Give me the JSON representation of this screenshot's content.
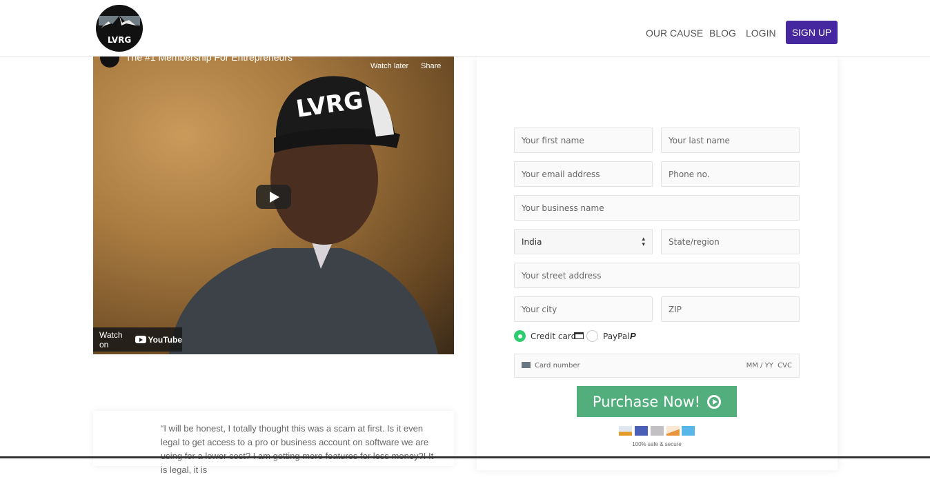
{
  "header": {
    "logo_text": "LVRG",
    "nav": [
      "OUR CAUSE",
      "BLOG",
      "LOGIN"
    ],
    "signup_label": "SIGN UP",
    "signup_color": "#4527a0"
  },
  "video": {
    "title": "The #1 Membership For Entrepreneurs",
    "watch_later": "Watch later",
    "share": "Share",
    "watch_on": "Watch on",
    "youtube": "YouTube",
    "hat_text": "LVRG"
  },
  "testimonial": {
    "text": "“I will be honest, I totally thought this was a scam at first. Is it even legal to get access to a pro or business account on software we are using for a lower cost? I am getting more features for less money?! It is legal, it is"
  },
  "form": {
    "first_name": "Your first name",
    "last_name": "Your last name",
    "email": "Your email address",
    "phone": "Phone no.",
    "business": "Your business name",
    "country": "India",
    "state": "State/region",
    "street": "Your street address",
    "city": "Your city",
    "zip": "ZIP",
    "payment_options": [
      {
        "label": "Credit card",
        "selected": true
      },
      {
        "label": "PayPal",
        "selected": false
      }
    ],
    "card_number": "Card number",
    "card_exp_cvc": "MM / YY  CVC",
    "purchase_label": "Purchase Now!",
    "purchase_color": "#52ae7d",
    "card_brands": [
      "visa",
      "mastercard",
      "generic",
      "discover",
      "amex"
    ],
    "secure_text": "100% safe & secure"
  }
}
